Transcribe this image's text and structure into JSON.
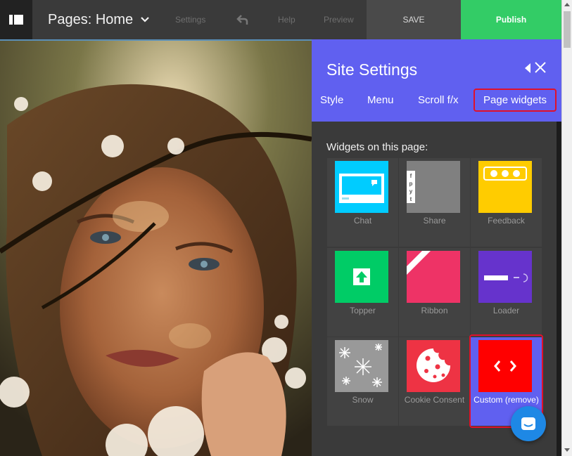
{
  "toolbar": {
    "page_title": "Pages: Home",
    "settings_label": "Settings",
    "help_label": "Help",
    "preview_label": "Preview",
    "save_label": "SAVE",
    "publish_label": "Publish"
  },
  "panel": {
    "title": "Site Settings",
    "tabs": [
      "Style",
      "Menu",
      "Scroll f/x",
      "Page widgets"
    ],
    "active_tab": "Page widgets",
    "widgets_heading": "Widgets on this page:",
    "widgets": [
      {
        "label": "Chat",
        "color": "#00ccff",
        "icon": "chat-icon"
      },
      {
        "label": "Share",
        "color": "#808080",
        "icon": "share-icon"
      },
      {
        "label": "Feedback",
        "color": "#ffcc00",
        "icon": "feedback-icon"
      },
      {
        "label": "Topper",
        "color": "#00cc66",
        "icon": "arrow-up-icon"
      },
      {
        "label": "Ribbon",
        "color": "#ee3366",
        "icon": "ribbon-icon"
      },
      {
        "label": "Loader",
        "color": "#6633cc",
        "icon": "loader-icon"
      },
      {
        "label": "Snow",
        "color": "#999999",
        "icon": "snowflake-icon"
      },
      {
        "label": "Cookie Consent",
        "color": "#ee3344",
        "icon": "cookie-icon"
      },
      {
        "label": "Custom (remove)",
        "color": "#ff0000",
        "icon": "code-icon"
      }
    ]
  },
  "colors": {
    "accent": "#6060f0",
    "publish": "#33cc66",
    "highlight": "#e0102a",
    "chat_button": "#1e88e5"
  }
}
